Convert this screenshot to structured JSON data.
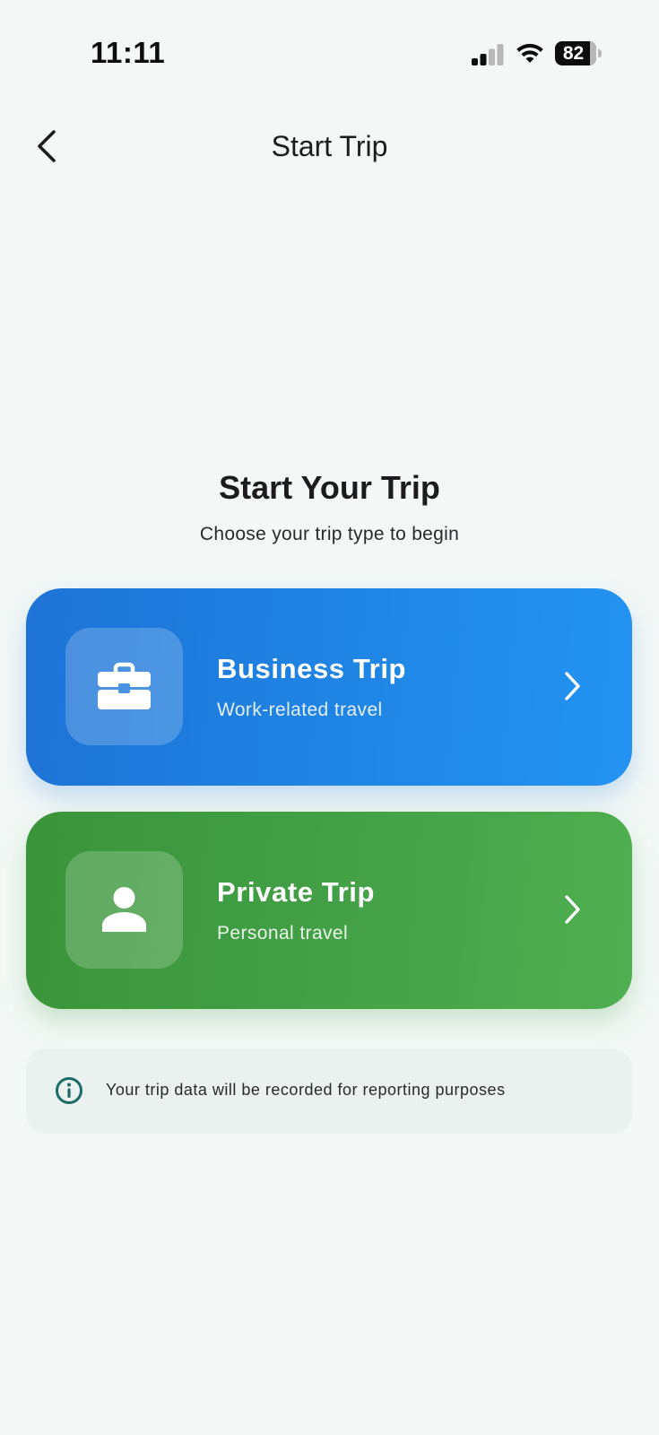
{
  "status_bar": {
    "time": "11:11",
    "battery_level": "82"
  },
  "nav": {
    "title": "Start Trip",
    "back_icon": "chevron-left-icon"
  },
  "hero": {
    "title": "Start Your Trip",
    "subtitle": "Choose your trip type to begin"
  },
  "trip_options": [
    {
      "title": "Business Trip",
      "subtitle": "Work-related travel",
      "icon": "briefcase-icon",
      "color": "#1f84e4"
    },
    {
      "title": "Private Trip",
      "subtitle": "Personal travel",
      "icon": "person-icon",
      "color": "#43a046"
    }
  ],
  "info": {
    "icon": "info-icon",
    "text": "Your trip data will be recorded for reporting purposes",
    "accent_color": "#1c6b66"
  }
}
